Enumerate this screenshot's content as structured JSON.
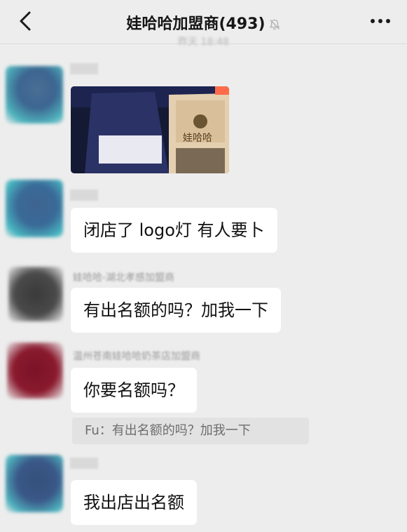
{
  "header": {
    "title": "娃哈哈加盟商(493)",
    "back_icon": "chevron-left-icon",
    "mute_icon": "bell-off-icon",
    "more_icon": "ellipsis-icon"
  },
  "timestamp": "昨天 18:48",
  "messages": [
    {
      "type": "image",
      "caption_on_sign": "娃哈哈"
    },
    {
      "type": "text",
      "text": "闭店了 logo灯 有人要卜"
    },
    {
      "type": "text",
      "sender": "娃哈哈-湖北孝感加盟商",
      "text": "有出名额的吗？加我一下"
    },
    {
      "type": "text",
      "sender": "温州苍南娃哈哈奶茶店加盟商",
      "text": "你要名额吗？",
      "quote": "Fu：有出名额的吗？加我一下"
    },
    {
      "type": "text",
      "text": "我出店出名额"
    }
  ]
}
